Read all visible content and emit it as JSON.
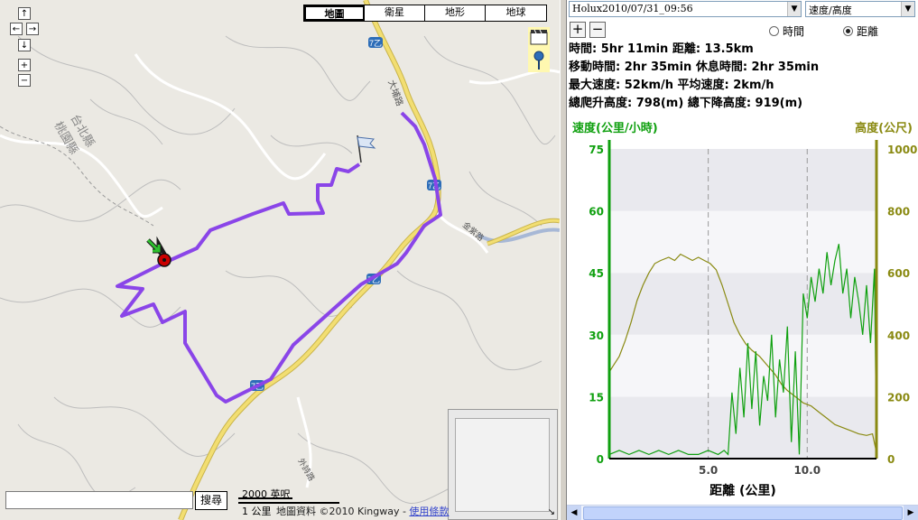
{
  "map": {
    "nav": {
      "pan_up": "↑",
      "pan_left": "←",
      "pan_right": "→",
      "pan_down": "↓",
      "zoom_in": "+",
      "zoom_out": "−"
    },
    "map_types": [
      "地圖",
      "衛星",
      "地形",
      "地球"
    ],
    "active_map_type": "地圖",
    "search": {
      "value": "",
      "button_label": "搜尋"
    },
    "scale": {
      "imperial": "2000 英呎",
      "metric": "1 公里"
    },
    "attribution": {
      "text": "地圖資料 ©2010 Kingway - ",
      "terms_link": "使用條款"
    },
    "labels": {
      "county": "台北縣",
      "county2": "桃園縣",
      "road_daxi": "大埔路",
      "road_jinhe": "金紫路",
      "road_waixing": "外詩路",
      "road_badge": "7乙"
    },
    "colors": {
      "track": "#8a45e8",
      "highway": "#f2de72",
      "road": "#ffffff",
      "bg": "#ebe9e3"
    },
    "icons": {
      "start": "green-arrow-icon",
      "end": "flag-icon",
      "current": "red-dot-marker-icon"
    }
  },
  "panel": {
    "track_select": "Holux2010/07/31_09:56",
    "chart_mode_select": "速度/高度",
    "zoom_in_label": "+",
    "zoom_out_label": "−",
    "x_axis_mode": {
      "time_label": "時間",
      "distance_label": "距離",
      "selected": "距離"
    },
    "stats": {
      "line1": "時間: 5hr 11min  距離: 13.5km",
      "line2": "移動時間: 2hr 35min  休息時間: 2hr 35min",
      "line3": "最大速度: 52km/h  平均速度: 2km/h",
      "line4": "總爬升高度: 798(m)  總下降高度: 919(m)"
    }
  },
  "chart_data": {
    "type": "line",
    "title": "",
    "xlabel": "距離 (公里)",
    "ylabel_left": "速度(公里/小時)",
    "ylabel_right": "高度(公尺)",
    "xlim": [
      0,
      13.5
    ],
    "ylim_left": [
      0,
      75
    ],
    "ylim_right": [
      0,
      1000
    ],
    "x_ticks": [
      {
        "v": 5,
        "label": "5.0"
      },
      {
        "v": 10,
        "label": "10.0"
      }
    ],
    "y_ticks_left": [
      "0",
      "15",
      "30",
      "45",
      "60",
      "75"
    ],
    "y_ticks_right": [
      "0",
      "200",
      "400",
      "600",
      "800",
      "1000"
    ],
    "grid": true,
    "colors": {
      "speed": "#0fa00f",
      "altitude": "#8a8a12",
      "plot_bg_a": "#e9e9ee",
      "plot_bg_b": "#f6f6f9"
    },
    "series": [
      {
        "axis": "right",
        "x": [
          0,
          0.2,
          0.5,
          0.8,
          1.1,
          1.4,
          1.7,
          2.0,
          2.3,
          2.6,
          3.0,
          3.3,
          3.6,
          3.9,
          4.2,
          4.5,
          4.8,
          5.1,
          5.4,
          5.7,
          6.0,
          6.3,
          6.6,
          6.9,
          7.2,
          7.6,
          8.0,
          8.4,
          8.7,
          9.0,
          9.4,
          9.8,
          10.2,
          10.6,
          11.0,
          11.4,
          11.8,
          12.2,
          12.6,
          13.0,
          13.3,
          13.5
        ],
        "values": [
          280,
          300,
          330,
          380,
          440,
          510,
          560,
          600,
          630,
          640,
          650,
          640,
          660,
          650,
          640,
          650,
          640,
          630,
          610,
          560,
          500,
          440,
          400,
          370,
          350,
          330,
          300,
          270,
          240,
          220,
          200,
          180,
          170,
          150,
          130,
          110,
          100,
          90,
          80,
          75,
          80,
          20
        ]
      },
      {
        "axis": "left",
        "x": [
          0,
          0.5,
          1,
          1.5,
          2,
          2.5,
          3,
          3.5,
          4,
          4.5,
          5,
          5.5,
          5.8,
          6.0,
          6.2,
          6.4,
          6.6,
          6.8,
          7.0,
          7.2,
          7.4,
          7.6,
          7.8,
          8.0,
          8.2,
          8.4,
          8.6,
          8.8,
          9.0,
          9.2,
          9.4,
          9.6,
          9.8,
          10.0,
          10.2,
          10.4,
          10.6,
          10.8,
          11.0,
          11.2,
          11.4,
          11.6,
          11.8,
          12.0,
          12.2,
          12.4,
          12.6,
          12.8,
          13.0,
          13.2,
          13.4,
          13.5
        ],
        "values": [
          1,
          2,
          1,
          2,
          1,
          2,
          1,
          2,
          1,
          1,
          2,
          1,
          2,
          1,
          16,
          6,
          22,
          10,
          28,
          12,
          26,
          8,
          20,
          14,
          30,
          10,
          24,
          16,
          32,
          4,
          26,
          1,
          40,
          34,
          44,
          38,
          46,
          40,
          50,
          42,
          48,
          52,
          40,
          46,
          34,
          44,
          38,
          30,
          42,
          28,
          46,
          2
        ]
      }
    ]
  },
  "status": {
    "corner_symbol": "↘",
    "scroll_left": "◀",
    "scroll_right": "▶"
  }
}
